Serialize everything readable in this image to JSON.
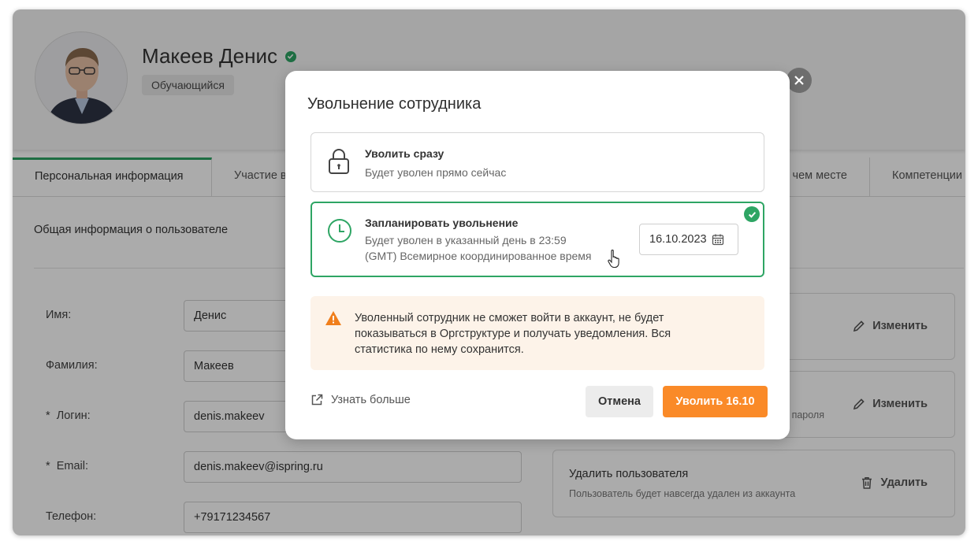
{
  "profile": {
    "name": "Макеев Денис",
    "role_badge": "Обучающийся",
    "avatar_alt": "user-photo"
  },
  "tabs": [
    {
      "label": "Персональная информация",
      "active": true
    },
    {
      "label": "Участие в"
    },
    {
      "label": "чем месте"
    },
    {
      "label": "Компетенции"
    }
  ],
  "section": {
    "title": "Общая информация о пользователе"
  },
  "form": {
    "first_name": {
      "label": "Имя:",
      "value": "Денис"
    },
    "last_name": {
      "label": "Фамилия:",
      "value": "Макеев"
    },
    "login": {
      "label": "*  Логин:",
      "value": "denis.makeev"
    },
    "email": {
      "label": "*  Email:",
      "value": "denis.makeev@ispring.ru"
    },
    "phone": {
      "label": "Телефон:",
      "value": "+79171234567"
    }
  },
  "side_panels": {
    "panel1": {
      "action": "Изменить"
    },
    "panel2": {
      "sub_partial": "пароля",
      "action": "Изменить"
    },
    "delete": {
      "title": "Удалить пользователя",
      "sub": "Пользователь будет навсегда удален из аккаунта",
      "action": "Удалить"
    }
  },
  "modal": {
    "title": "Увольнение сотрудника",
    "option_now": {
      "title": "Уволить сразу",
      "sub": "Будет уволен прямо сейчас"
    },
    "option_scheduled": {
      "title": "Запланировать увольнение",
      "sub_line1": "Будет уволен в указанный день в 23:59",
      "sub_line2": "(GMT) Всемирное координированное время",
      "date": "16.10.2023",
      "selected": true
    },
    "warning": "Уволенный сотрудник не сможет войти в аккаунт, не будет показываться в Оргструктуре и получать уведомления. Вся статистика по нему сохранится.",
    "learn_more": "Узнать больше",
    "cancel": "Отмена",
    "confirm": "Уволить 16.10"
  },
  "colors": {
    "accent_green": "#2ea564",
    "primary_orange": "#fa8a28",
    "warning_bg": "#fdf3e9",
    "warning_icon": "#f07e1b"
  }
}
